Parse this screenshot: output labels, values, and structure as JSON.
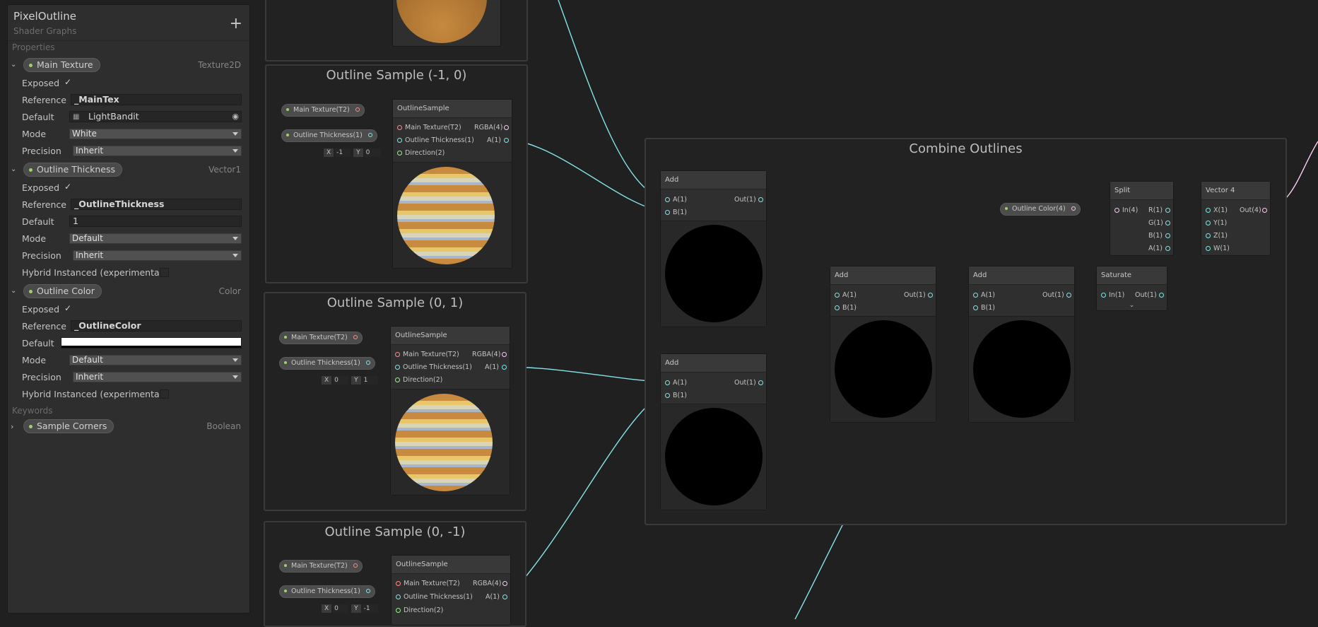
{
  "blackboard": {
    "title": "PixelOutline",
    "subtitle": "Shader Graphs",
    "add_label": "+",
    "properties_header": "Properties",
    "keywords_header": "Keywords",
    "labels": {
      "exposed": "Exposed",
      "reference": "Reference",
      "default": "Default",
      "mode": "Mode",
      "precision": "Precision",
      "hybrid": "Hybrid Instanced (experimental)"
    },
    "properties": [
      {
        "name": "Main Texture",
        "type": "Texture2D",
        "exposed": "✓",
        "reference": "_MainTex",
        "default": "LightBandit",
        "mode": "White",
        "precision": "Inherit"
      },
      {
        "name": "Outline Thickness",
        "type": "Vector1",
        "exposed": "✓",
        "reference": "_OutlineThickness",
        "default": "1",
        "mode": "Default",
        "precision": "Inherit"
      },
      {
        "name": "Outline Color",
        "type": "Color",
        "exposed": "✓",
        "reference": "_OutlineColor",
        "default_color": "#ffffff",
        "mode": "Default",
        "precision": "Inherit"
      }
    ],
    "keywords": [
      {
        "name": "Sample Corners",
        "type": "Boolean"
      }
    ]
  },
  "groups": {
    "g1": "Outline Sample (-1, 0)",
    "g2": "Outline Sample (0, 1)",
    "g3": "Outline Sample (0, -1)",
    "combine": "Combine Outlines"
  },
  "pills": {
    "main_texture": "Main Texture(T2)",
    "outline_thickness": "Outline Thickness(1)",
    "outline_color": "Outline Color(4)"
  },
  "outline_sample": {
    "title": "OutlineSample",
    "in1": "Main Texture(T2)",
    "in2": "Outline Thickness(1)",
    "in3": "Direction(2)",
    "out1": "RGBA(4)",
    "out2": "A(1)"
  },
  "directions": [
    {
      "x_label": "X",
      "x": "-1",
      "y_label": "Y",
      "y": "0"
    },
    {
      "x_label": "X",
      "x": "0",
      "y_label": "Y",
      "y": "1"
    },
    {
      "x_label": "X",
      "x": "0",
      "y_label": "Y",
      "y": "-1"
    }
  ],
  "add": {
    "title": "Add",
    "a": "A(1)",
    "b": "B(1)",
    "out": "Out(1)"
  },
  "saturate": {
    "title": "Saturate",
    "in": "In(1)",
    "out": "Out(1)"
  },
  "split": {
    "title": "Split",
    "in": "In(4)",
    "r": "R(1)",
    "g": "G(1)",
    "b": "B(1)",
    "a": "A(1)"
  },
  "vector4": {
    "title": "Vector 4",
    "x": "X(1)",
    "y": "Y(1)",
    "z": "Z(1)",
    "w": "W(1)",
    "out": "Out(4)"
  },
  "colors": {
    "float_port": "#84e4e7",
    "texture_port": "#ff8b8b",
    "vector2_port": "#9aef92",
    "vector4_port": "#fbcbf4",
    "property_dot": "#9ed167"
  }
}
